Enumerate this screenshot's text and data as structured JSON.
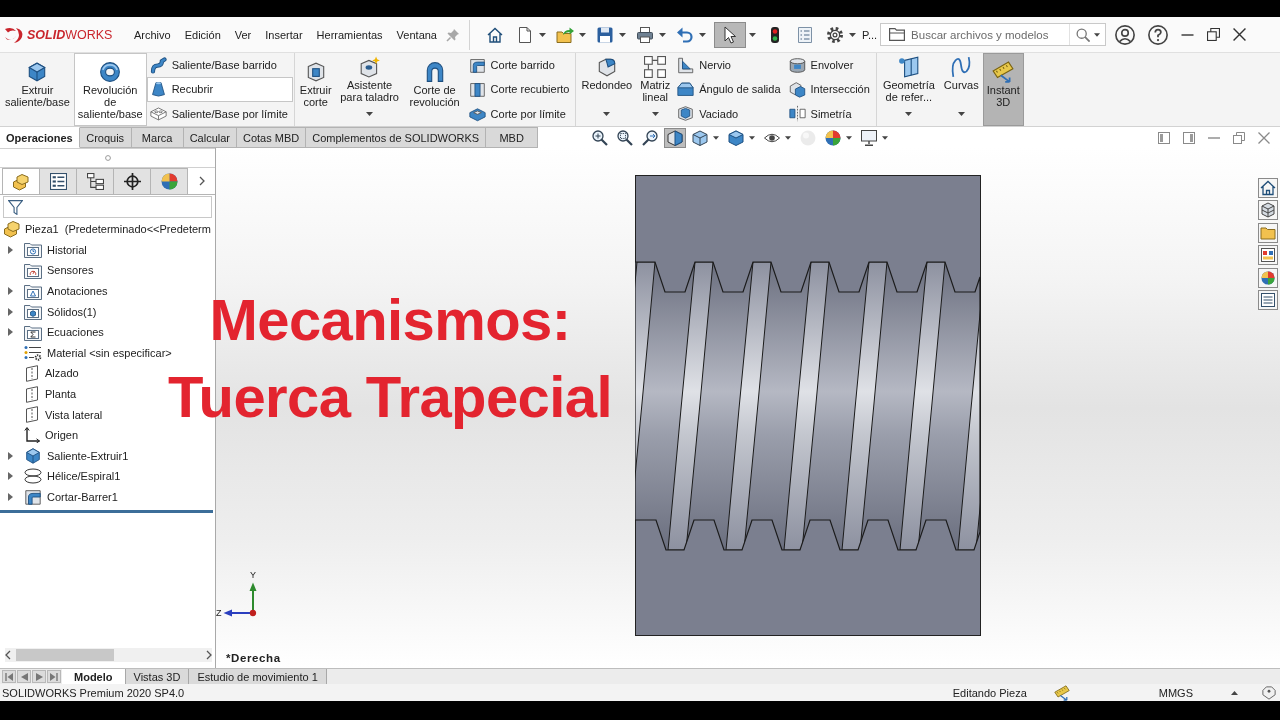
{
  "title_bar": {
    "logo": "**SOLID**WORKS",
    "menu": [
      "Archivo",
      "Edición",
      "Ver",
      "Insertar",
      "Herramientas",
      "Ventana"
    ],
    "quick_access": [
      {
        "dropdown": false,
        "selected": false
      },
      {
        "dropdown": true,
        "selected": false
      },
      {
        "dropdown": true,
        "selected": false
      },
      {
        "dropdown": true,
        "selected": false
      },
      {
        "dropdown": true,
        "selected": false
      },
      {
        "dropdown": true,
        "selected": false
      },
      {
        "dropdown": true,
        "selected": true
      },
      {
        "dropdown": false,
        "selected": false
      },
      {
        "dropdown": false,
        "selected": false
      },
      {
        "dropdown": true,
        "selected": false
      }
    ],
    "document_label": "P...",
    "search": {
      "placeholder": "Buscar archivos y modelos"
    }
  },
  "ribbon": {
    "groups": [
      {
        "columns": [
          {
            "kind": "large",
            "label": "Extruir saliente/base",
            "dropdown": false,
            "highlighted": false,
            "selected": false
          },
          {
            "kind": "large",
            "label": "Revolución de saliente/base",
            "dropdown": false,
            "highlighted": true,
            "selected": false
          },
          {
            "kind": "stack",
            "items": [
              {
                "label": "Saliente/Base barrido",
                "highlighted": false
              },
              {
                "label": "Recubrir",
                "highlighted": true
              },
              {
                "label": "Saliente/Base por límite",
                "highlighted": false
              }
            ]
          }
        ]
      },
      {
        "columns": [
          {
            "kind": "large",
            "label": "Extruir corte",
            "dropdown": false,
            "highlighted": false,
            "selected": false
          },
          {
            "kind": "large",
            "label": "Asistente para taladro",
            "dropdown": true,
            "highlighted": false,
            "selected": false
          },
          {
            "kind": "large",
            "label": "Corte de revolución",
            "dropdown": false,
            "highlighted": false,
            "selected": false
          },
          {
            "kind": "stack",
            "items": [
              {
                "label": "Corte barrido",
                "highlighted": false
              },
              {
                "label": "Corte recubierto",
                "highlighted": false
              },
              {
                "label": "Corte por límite",
                "highlighted": false
              }
            ]
          }
        ]
      },
      {
        "columns": [
          {
            "kind": "large",
            "label": "Redondeo",
            "dropdown": true,
            "highlighted": false,
            "selected": false
          },
          {
            "kind": "large",
            "label": "Matriz lineal",
            "dropdown": true,
            "highlighted": false,
            "selected": false
          },
          {
            "kind": "stack",
            "items": [
              {
                "label": "Nervio",
                "highlighted": false
              },
              {
                "label": "Ángulo de salida",
                "highlighted": false
              },
              {
                "label": "Vaciado",
                "highlighted": false
              }
            ]
          },
          {
            "kind": "stack",
            "items": [
              {
                "label": "Envolver",
                "highlighted": false
              },
              {
                "label": "Intersección",
                "highlighted": false
              },
              {
                "label": "Simetría",
                "highlighted": false
              }
            ]
          }
        ]
      },
      {
        "columns": [
          {
            "kind": "large",
            "label": "Geometría de refer...",
            "dropdown": true,
            "highlighted": false,
            "selected": false
          },
          {
            "kind": "large",
            "label": "Curvas",
            "dropdown": true,
            "highlighted": false,
            "selected": false
          },
          {
            "kind": "large",
            "label": "Instant 3D",
            "dropdown": false,
            "highlighted": false,
            "selected": true
          }
        ]
      }
    ]
  },
  "command_tabs": [
    {
      "label": "Operaciones",
      "selected": true
    },
    {
      "label": "Croquis",
      "selected": false
    },
    {
      "label": "Marca",
      "selected": false
    },
    {
      "label": "Calcular",
      "selected": false
    },
    {
      "label": "Cotas MBD",
      "selected": false
    },
    {
      "label": "Complementos de SOLIDWORKS",
      "selected": false
    },
    {
      "label": "MBD",
      "selected": false
    }
  ],
  "view_toolbar": [
    {
      "dropdown": false,
      "selected": false,
      "disabled": false
    },
    {
      "dropdown": false,
      "selected": false,
      "disabled": false
    },
    {
      "dropdown": false,
      "selected": false,
      "disabled": false
    },
    {
      "dropdown": false,
      "selected": true,
      "disabled": false
    },
    {
      "dropdown": true,
      "selected": false,
      "disabled": false
    },
    {
      "dropdown": true,
      "selected": false,
      "disabled": false
    },
    {
      "dropdown": true,
      "selected": false,
      "disabled": false
    },
    {
      "dropdown": false,
      "selected": false,
      "disabled": true
    },
    {
      "dropdown": true,
      "selected": false,
      "disabled": false
    },
    {
      "dropdown": true,
      "selected": false,
      "disabled": false
    }
  ],
  "panel_tabs": [
    {
      "selected": true
    },
    {
      "selected": false
    },
    {
      "selected": false
    },
    {
      "selected": false
    },
    {
      "selected": false
    }
  ],
  "feature_tree": {
    "root": {
      "label": "Pieza1  (Predeterminado<<Predeterm",
      "children": [
        {
          "label": "Historial",
          "collapsed": true
        },
        {
          "label": "Sensores",
          "collapsed": false
        },
        {
          "label": "Anotaciones",
          "collapsed": true
        },
        {
          "label": "Sólidos(1)",
          "collapsed": true
        },
        {
          "label": "Ecuaciones",
          "collapsed": true
        },
        {
          "label": "Material <sin especificar>",
          "collapsed": false
        },
        {
          "label": "Alzado",
          "collapsed": false
        },
        {
          "label": "Planta",
          "collapsed": false
        },
        {
          "label": "Vista lateral",
          "collapsed": false
        },
        {
          "label": "Origen",
          "collapsed": false
        },
        {
          "label": "Saliente-Extruir1",
          "collapsed": true
        },
        {
          "label": "Hélice/Espiral1",
          "collapsed": true
        },
        {
          "label": "Cortar-Barrer1",
          "collapsed": true
        }
      ]
    }
  },
  "viewport": {
    "view_name": "*Derecha",
    "triad_axes": [
      "Y",
      "Z"
    ]
  },
  "overlay_title": [
    "Mecanismos:",
    "Tuerca Trapecial"
  ],
  "model_tabs": [
    {
      "label": "Modelo",
      "selected": true
    },
    {
      "label": "Vistas 3D",
      "selected": false
    },
    {
      "label": "Estudio de movimiento 1",
      "selected": false
    }
  ],
  "status_bar": {
    "product": "SOLIDWORKS Premium 2020 SP4.0",
    "mode": "Editando Pieza",
    "units": "MMGS"
  }
}
